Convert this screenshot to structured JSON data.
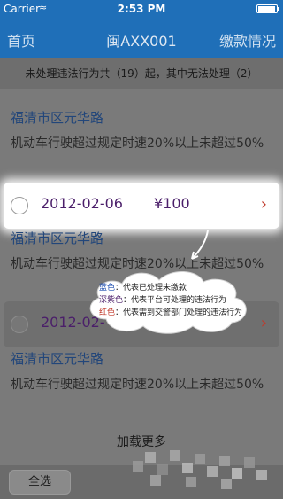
{
  "status_bar": {
    "carrier": "Carrier",
    "time": "2:53 PM",
    "battery_level": 0.95
  },
  "nav": {
    "back": "首页",
    "title": "闽AXX001",
    "right": "缴款情况"
  },
  "summary": "未处理违法行为共（19）起，其中无法处理（2）",
  "records": [
    {
      "road": "福清市区元华路",
      "desc": "机动车行驶超过规定时速20%以上未超过50%"
    },
    {
      "date": "2012-02-06",
      "amount": "¥100",
      "road": "福清市区元华路",
      "desc": "机动车行驶超过规定时速20%以上未超过50%"
    },
    {
      "date": "2012-02-",
      "road": "福清市区元华路",
      "desc": "机动车行驶超过规定时速20%以上未超过50%"
    }
  ],
  "load_more": "加载更多",
  "select_all": "全选",
  "legend": {
    "blue_key": "蓝色",
    "blue_desc": "：代表已处理未缴款",
    "purple_key": "深紫色",
    "purple_desc": "：代表平台可处理的违法行为",
    "red_key": "红色",
    "red_desc": "：代表需到交警部门处理的违法行为"
  },
  "colors": {
    "nav": "#1f6fb8",
    "date_text": "#4b1f6a",
    "road_text": "#22467a",
    "chevron": "#c0392b"
  }
}
